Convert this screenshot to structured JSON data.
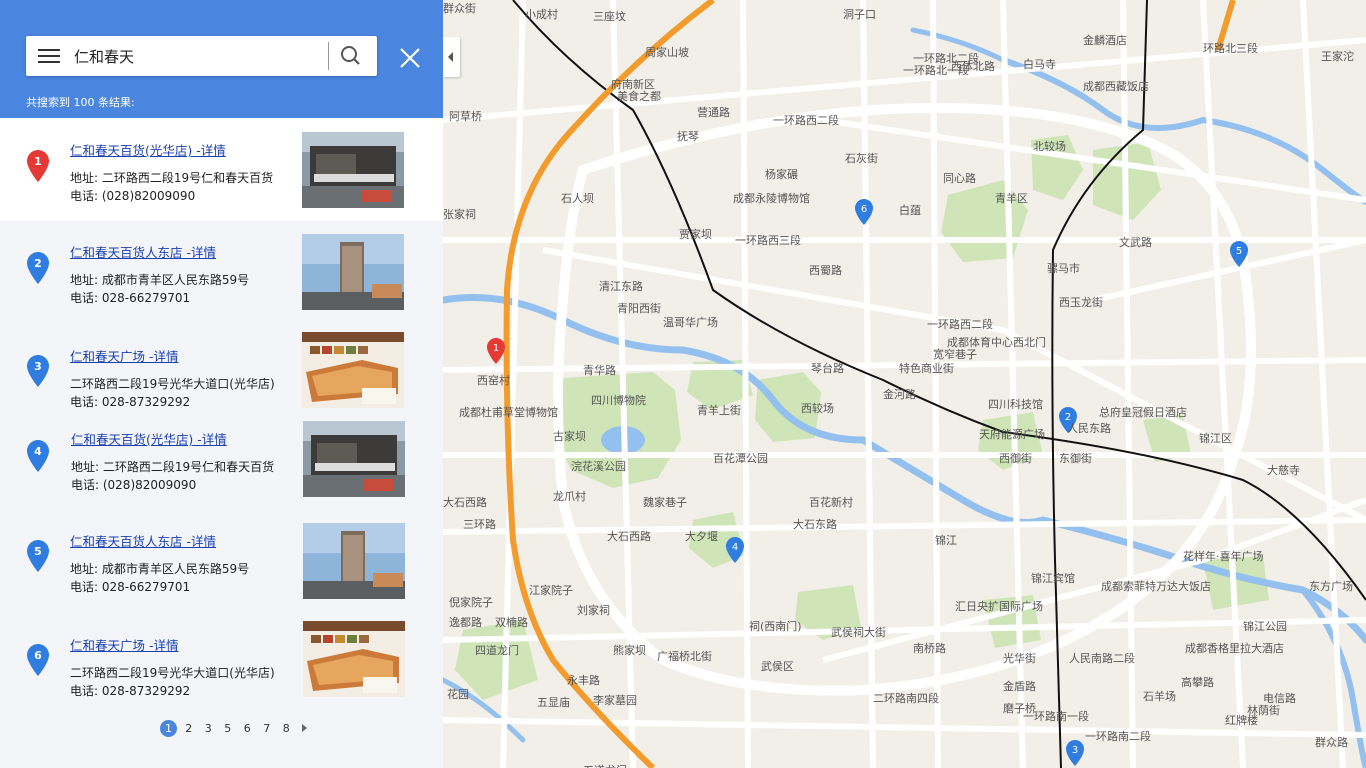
{
  "search": {
    "query": "仁和春天",
    "count_text": "共搜索到 100 条结果:"
  },
  "results": [
    {
      "num": "1",
      "title": "仁和春天百货(光华店) -详情",
      "address": "地址:  二环路西二段19号仁和春天百货",
      "phone": "电话:  (028)82009090",
      "pin_color": "#e53935",
      "thumb": "storefront"
    },
    {
      "num": "2",
      "title": "仁和春天百货人东店 -详情",
      "address": "地址: 成都市青羊区人民东路59号",
      "phone": "电话: 028-66279701",
      "pin_color": "#2f7de0",
      "thumb": "tower"
    },
    {
      "num": "3",
      "title": "仁和春天广场 -详情",
      "address": "二环路西二段19号光华大道口(光华店)",
      "phone": "电话: 028-87329292",
      "pin_color": "#2f7de0",
      "thumb": "floorplan"
    },
    {
      "num": "4",
      "title": "仁和春天百货(光华店) -详情",
      "address": "地址:  二环路西二段19号仁和春天百货",
      "phone": "电话:  (028)82009090",
      "pin_color": "#2f7de0",
      "thumb": "storefront"
    },
    {
      "num": "5",
      "title": "仁和春天百货人东店 -详情",
      "address": "地址: 成都市青羊区人民东路59号",
      "phone": "电话: 028-66279701",
      "pin_color": "#2f7de0",
      "thumb": "tower"
    },
    {
      "num": "6",
      "title": "仁和春天广场 -详情",
      "address": "二环路西二段19号光华大道口(光华店)",
      "phone": "电话: 028-87329292",
      "pin_color": "#2f7de0",
      "thumb": "floorplan"
    }
  ],
  "pager": {
    "pages": [
      "1",
      "2",
      "3",
      "5",
      "6",
      "7",
      "8"
    ],
    "current": "1"
  },
  "map": {
    "labels": [
      "小成村",
      "三座坟",
      "洞子口",
      "一环路北二段",
      "金麟酒店",
      "环路北三段",
      "王家沱",
      "周家山坡",
      "一环路北一段",
      "西体北路",
      "白马寺",
      "府南新区",
      "美食之都",
      "成都西藏饭店",
      "阿草桥",
      "营通路",
      "抚琴",
      "一环路西二段",
      "石灰街",
      "北较场",
      "杨家碾",
      "同心路",
      "青羊区",
      "石人坝",
      "成都永陵博物馆",
      "白蕴",
      "贾家坝",
      "张家祠",
      "文武路",
      "一环路西三段",
      "西蜀路",
      "骡马市",
      "西玉龙街",
      "清江东路",
      "青阳西街",
      "温哥华广场",
      "一环路西二段",
      "成都体育中心西北门",
      "宽窄巷子",
      "特色商业街",
      "琴台路",
      "金河路",
      "青华路",
      "西窑村",
      "四川博物院",
      "西较场",
      "四川科技馆",
      "总府皇冠假日酒店",
      "成都杜甫草堂博物馆",
      "青羊上街",
      "天府能源广场",
      "人民东路",
      "锦江区",
      "古家坝",
      "浣花溪公园",
      "百花潭公园",
      "西御街",
      "东御街",
      "大慈寺",
      "龙爪村",
      "魏家巷子",
      "百花新村",
      "大石西路",
      "大夕堰",
      "大石东路",
      "花样年·喜年广场",
      "东方广场",
      "锦江宾馆",
      "成都索菲特万达大饭店",
      "江家院子",
      "刘家祠",
      "汇日央扩国际广场",
      "倪家院子",
      "逸都路",
      "双楠路",
      "熊家坝",
      "祠(西南门)",
      "武侯祠大街",
      "成都香格里拉大酒店",
      "四道龙门",
      "锦江",
      "武侯区",
      "李家墓园",
      "二环路南四段",
      "一环路南一段",
      "林荫街",
      "一环路南二段",
      "群众路",
      "红牌楼",
      "五道龙门",
      "花园",
      "大石西路",
      "三环路",
      "锦江公园",
      "南桥路",
      "广福桥北街",
      "永丰路",
      "五显庙",
      "光华街",
      "人民南路二段",
      "金盾路",
      "石羊场",
      "高攀路",
      "磨子桥",
      "电信路",
      "群众街"
    ],
    "pins": [
      {
        "num": "1",
        "color": "#e53935"
      },
      {
        "num": "2",
        "color": "#2f7de0"
      },
      {
        "num": "3",
        "color": "#2f7de0"
      },
      {
        "num": "4",
        "color": "#2f7de0"
      },
      {
        "num": "5",
        "color": "#2f7de0"
      },
      {
        "num": "6",
        "color": "#2f7de0"
      }
    ]
  }
}
